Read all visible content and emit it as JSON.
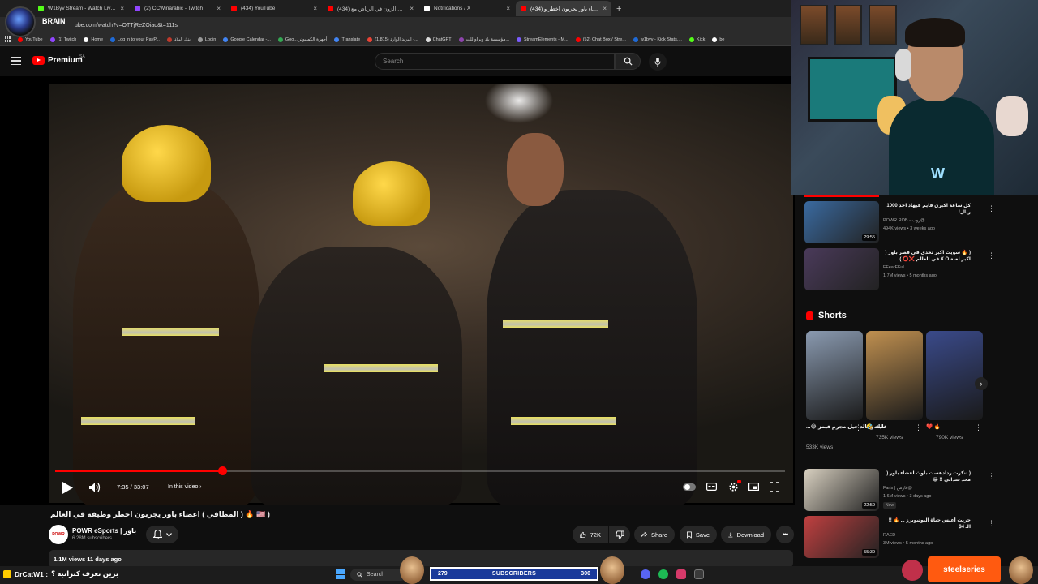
{
  "browser": {
    "tabs": [
      {
        "title": "W1Byv Stream - Watch Live on",
        "color": "#53fc18",
        "active": false
      },
      {
        "title": "(2) CCWinarabic - Twitch",
        "color": "#9146ff",
        "active": false
      },
      {
        "title": "(434) YouTube",
        "color": "#ff0000",
        "active": false
      },
      {
        "title": "(434) تحدي الزون في الرياض مع...",
        "color": "#ff0000",
        "active": false
      },
      {
        "title": "Notifications / X",
        "color": "#ffffff",
        "active": false
      },
      {
        "title": "(434) اعضاء باور يجربون اخطر و...",
        "color": "#ff0000",
        "active": true
      }
    ],
    "new_tab": "+",
    "url": "ube.com/watch?v=OTTjReZOiao&t=111s",
    "bookmarks": [
      {
        "label": "YouTube",
        "color": "#ff0000"
      },
      {
        "label": "(1) Twitch",
        "color": "#9146ff"
      },
      {
        "label": "Home",
        "color": "#ffffff"
      },
      {
        "label": "Log in to your PayP...",
        "color": "#1f6ad6"
      },
      {
        "label": "بنك البلاد",
        "color": "#c0392b"
      },
      {
        "label": "Login",
        "color": "#999999"
      },
      {
        "label": "Google Calendar -...",
        "color": "#4285f4"
      },
      {
        "label": "Goo... أجهزة الكمبيوتر",
        "color": "#34a853"
      },
      {
        "label": "Translate",
        "color": "#4285f4"
      },
      {
        "label": "(1,815) البريد الوارد -...",
        "color": "#ea4335"
      },
      {
        "label": "ChatGPT",
        "color": "#dddddd"
      },
      {
        "label": "مؤسسة باد وبراو للت...",
        "color": "#8e44ad"
      },
      {
        "label": "StreamElements - M...",
        "color": "#7b5cff"
      },
      {
        "label": "(52) Chat Box / Stre...",
        "color": "#ff0000"
      },
      {
        "label": "w1byv - Kick Stats,...",
        "color": "#1f6ad6"
      },
      {
        "label": "Kick",
        "color": "#53fc18"
      },
      {
        "label": "be",
        "color": "#ffffff"
      }
    ]
  },
  "stream_overlay": {
    "brand": "BRAIN"
  },
  "youtube_header": {
    "logo_text": "Premium",
    "country": "SA",
    "search_placeholder": "Search"
  },
  "player": {
    "time_current": "7:35",
    "time_total": "33:07",
    "time_display": "7:35 / 33:07",
    "progress_fraction": 0.229,
    "chapter_label": "In this video"
  },
  "video": {
    "title": "( 🇺🇸 🔥 ( المطافي ) اعضاء باور يجربون اخطر وظيفة في العالم",
    "channel_name": "POWR eSports | باور",
    "subscribers": "6.28M subscribers",
    "likes": "72K",
    "share_label": "Share",
    "save_label": "Save",
    "download_label": "Download",
    "views_date": "1.1M views  11 days ago"
  },
  "sidebar": {
    "recommendations_top": [
      {
        "title": "كل ساعة اكبرن قايم فيهاد اخذ 1000 ريال!",
        "channel": "POWR ROB - روب@",
        "meta": "494K views • 3 weeks ago",
        "duration": "29:55",
        "thumb_color": "#3a6aa0"
      },
      {
        "title": "( 🔥 سويت اكبر تحدي في قصر باور ( اكبر لعبة X O في العالم ❌⭕ )",
        "channel": "FFearFFul",
        "meta": "1.7M views • 5 months ago",
        "duration": "",
        "thumb_color": "#4a3a5a"
      }
    ],
    "shorts_title": "Shorts",
    "shorts": [
      {
        "title": "ملك وخالد حيل مجرم فيمز 😂...",
        "views": "533K views",
        "color": "#8a9ab0"
      },
      {
        "title": "ذليته 🤣",
        "views": "735K views",
        "color": "#c09050"
      },
      {
        "title": "🔥 ❤️",
        "views": "790K views",
        "color": "#3a4a8a"
      }
    ],
    "recommendations_bottom": [
      {
        "title": "( تنكرت ردادهست بلوث اعضاء باور ( محد سداني !! 😂",
        "channel": "Faris | فارس@",
        "meta": "1.6M views • 3 days ago",
        "badge": "New",
        "duration": "22:59",
        "thumb_color": "#d8d0c0"
      },
      {
        "title": "جربت أعيش حياة اليوتيوبرز ... 🔥 !! الـ 4$",
        "channel": "RAED",
        "meta": "3M views • 5 months ago",
        "badge": "",
        "duration": "55:39",
        "thumb_color": "#c04040"
      }
    ]
  },
  "taskbar": {
    "chat_user": "DrCatW1 :",
    "chat_message": "برين تعرف كتزانيه ؟",
    "search_label": "Search",
    "sub_goal_current": "279",
    "sub_goal_label": "SUBSCRIBERS",
    "sub_goal_target": "300",
    "steelseries": "steelseries"
  },
  "colors": {
    "background": "#0f0f0f",
    "accent_red": "#ff0000",
    "pill_bg": "#272727"
  }
}
